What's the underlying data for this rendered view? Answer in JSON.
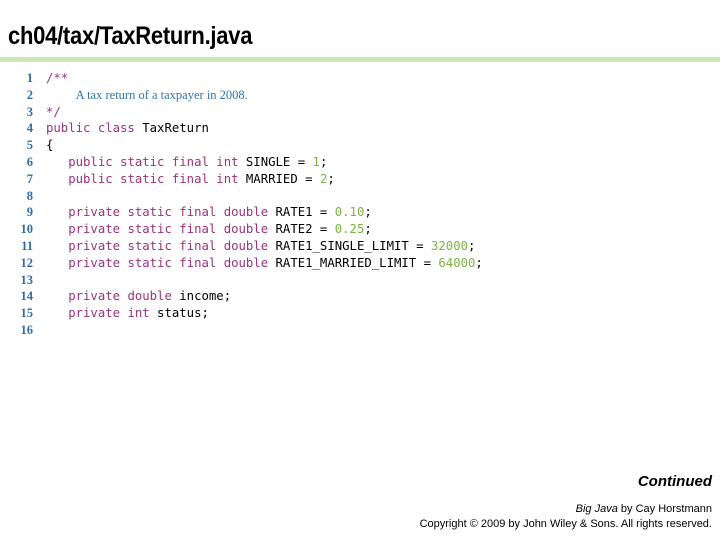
{
  "slide": {
    "title": "ch04/tax/TaxReturn.java",
    "rule_color": "#cfe6b4",
    "background_color": "#ffffff"
  },
  "syntax_colors": {
    "line_number": "#2f6da4",
    "keyword": "#99337f",
    "number_literal": "#7cb342",
    "comment": "#2e74a8",
    "plain": "#000000"
  },
  "code_listing": {
    "language": "java",
    "first_line": 1,
    "last_line": 16,
    "lines": [
      {
        "number": "1",
        "tokens": [
          {
            "text": "/**",
            "type": "keyword"
          }
        ]
      },
      {
        "number": "2",
        "tokens": [
          {
            "text": "    ",
            "type": "plain"
          },
          {
            "text": "A tax return of a taxpayer in 2008.",
            "type": "comment"
          }
        ]
      },
      {
        "number": "3",
        "tokens": [
          {
            "text": "*/",
            "type": "keyword"
          }
        ]
      },
      {
        "number": "4",
        "tokens": [
          {
            "text": "public class",
            "type": "keyword"
          },
          {
            "text": " TaxReturn",
            "type": "plain"
          }
        ]
      },
      {
        "number": "5",
        "tokens": [
          {
            "text": "{",
            "type": "plain"
          }
        ]
      },
      {
        "number": "6",
        "tokens": [
          {
            "text": "   ",
            "type": "plain"
          },
          {
            "text": "public static final int",
            "type": "keyword"
          },
          {
            "text": " SINGLE = ",
            "type": "plain"
          },
          {
            "text": "1",
            "type": "number"
          },
          {
            "text": ";",
            "type": "plain"
          }
        ]
      },
      {
        "number": "7",
        "tokens": [
          {
            "text": "   ",
            "type": "plain"
          },
          {
            "text": "public static final int",
            "type": "keyword"
          },
          {
            "text": " MARRIED = ",
            "type": "plain"
          },
          {
            "text": "2",
            "type": "number"
          },
          {
            "text": ";",
            "type": "plain"
          }
        ]
      },
      {
        "number": "8",
        "tokens": []
      },
      {
        "number": "9",
        "tokens": [
          {
            "text": "   ",
            "type": "plain"
          },
          {
            "text": "private static final double",
            "type": "keyword"
          },
          {
            "text": " RATE1 = ",
            "type": "plain"
          },
          {
            "text": "0.10",
            "type": "number"
          },
          {
            "text": ";",
            "type": "plain"
          }
        ]
      },
      {
        "number": "10",
        "tokens": [
          {
            "text": "   ",
            "type": "plain"
          },
          {
            "text": "private static final double",
            "type": "keyword"
          },
          {
            "text": " RATE2 = ",
            "type": "plain"
          },
          {
            "text": "0.25",
            "type": "number"
          },
          {
            "text": ";",
            "type": "plain"
          }
        ]
      },
      {
        "number": "11",
        "tokens": [
          {
            "text": "   ",
            "type": "plain"
          },
          {
            "text": "private static final double",
            "type": "keyword"
          },
          {
            "text": " RATE1_SINGLE_LIMIT = ",
            "type": "plain"
          },
          {
            "text": "32000",
            "type": "number"
          },
          {
            "text": ";",
            "type": "plain"
          }
        ]
      },
      {
        "number": "12",
        "tokens": [
          {
            "text": "   ",
            "type": "plain"
          },
          {
            "text": "private static final double",
            "type": "keyword"
          },
          {
            "text": " RATE1_MARRIED_LIMIT = ",
            "type": "plain"
          },
          {
            "text": "64000",
            "type": "number"
          },
          {
            "text": ";",
            "type": "plain"
          }
        ]
      },
      {
        "number": "13",
        "tokens": []
      },
      {
        "number": "14",
        "tokens": [
          {
            "text": "   ",
            "type": "plain"
          },
          {
            "text": "private double",
            "type": "keyword"
          },
          {
            "text": " income;",
            "type": "plain"
          }
        ]
      },
      {
        "number": "15",
        "tokens": [
          {
            "text": "   ",
            "type": "plain"
          },
          {
            "text": "private int",
            "type": "keyword"
          },
          {
            "text": " status;",
            "type": "plain"
          }
        ]
      },
      {
        "number": "16",
        "tokens": []
      }
    ]
  },
  "footer": {
    "continued_label": "Continued",
    "credit_book": "Big Java",
    "credit_rest": " by Cay Horstmann",
    "copyright": "Copyright © 2009 by John Wiley & Sons.  All rights reserved."
  }
}
